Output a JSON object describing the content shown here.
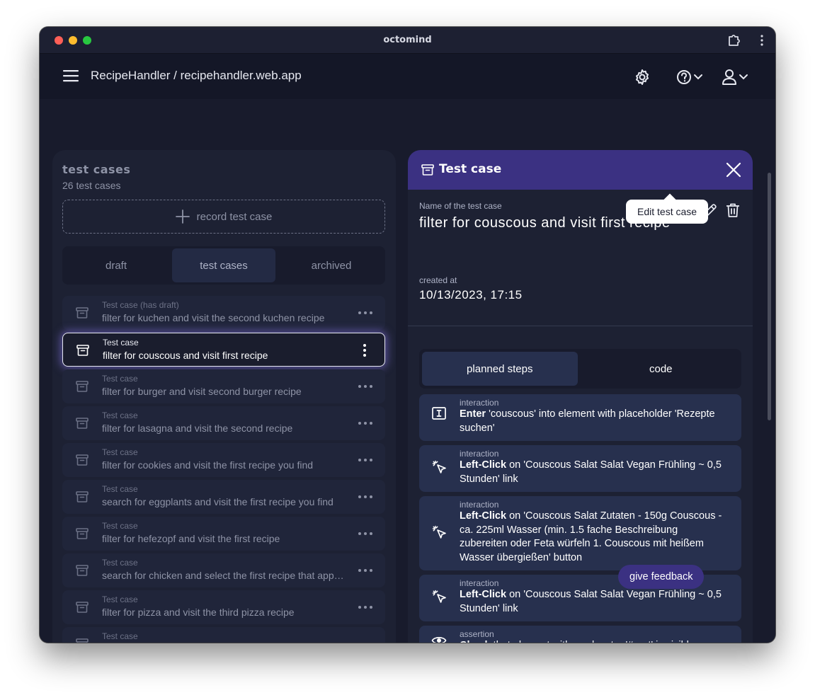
{
  "window": {
    "title": "octomind"
  },
  "appbar": {
    "project": "RecipeHandler / recipehandler.web.app"
  },
  "left_panel": {
    "title": "test cases",
    "count": "26 test cases",
    "record_label": "record test case",
    "tabs": [
      {
        "label": "draft",
        "active": false
      },
      {
        "label": "test cases",
        "active": true
      },
      {
        "label": "archived",
        "active": false
      }
    ],
    "items": [
      {
        "kind": "Test case (has draft)",
        "name": "filter for kuchen and visit the second kuchen recipe"
      },
      {
        "kind": "Test case",
        "name": "filter for couscous and visit first recipe",
        "selected": true
      },
      {
        "kind": "Test case",
        "name": "filter for burger and visit second burger recipe"
      },
      {
        "kind": "Test case",
        "name": "filter for lasagna and visit the second recipe"
      },
      {
        "kind": "Test case",
        "name": "filter for cookies and visit the first recipe you find"
      },
      {
        "kind": "Test case",
        "name": "search for eggplants and visit the first recipe you find"
      },
      {
        "kind": "Test case",
        "name": "filter for hefezopf and visit the first recipe"
      },
      {
        "kind": "Test case",
        "name": "search for chicken and select the first recipe that appears"
      },
      {
        "kind": "Test case",
        "name": "filter for pizza and visit the third pizza recipe"
      },
      {
        "kind": "Test case",
        "name": ""
      }
    ]
  },
  "detail": {
    "header_title": "Test case",
    "name_label": "Name of the test case",
    "name": "filter for couscous and visit first recipe",
    "created_label": "created at",
    "created_value": "10/13/2023, 17:15",
    "tabs": [
      {
        "label": "planned steps",
        "active": true
      },
      {
        "label": "code",
        "active": false
      }
    ],
    "steps": [
      {
        "kind": "interaction",
        "icon": "text-input-icon",
        "action": "Enter",
        "text": " 'couscous' into element with placeholder 'Rezepte suchen'"
      },
      {
        "kind": "interaction",
        "icon": "cursor-click-icon",
        "action": "Left-Click",
        "text": " on 'Couscous Salat Salat Vegan Frühling ~ 0,5 Stunden' link"
      },
      {
        "kind": "interaction",
        "icon": "cursor-click-icon",
        "action": "Left-Click",
        "text": " on 'Couscous Salat Zutaten - 150g Couscous - ca. 225ml Wasser (min. 1.5 fache Beschreibung zubereiten oder Feta würfeln 1. Couscous mit heißem Wasser übergießen' button"
      },
      {
        "kind": "interaction",
        "icon": "cursor-click-icon",
        "action": "Left-Click",
        "text": " on 'Couscous Salat Salat Vegan Frühling ~ 0,5 Stunden' link"
      },
      {
        "kind": "assertion",
        "icon": "eye-icon",
        "action": "Check",
        "text": " that element with css locator '#root' is visible"
      }
    ]
  },
  "tooltip": {
    "text": "Edit test case"
  },
  "feedback": {
    "label": "give feedback"
  },
  "colors": {
    "background": "#181b2c",
    "panel": "#1d2133",
    "accent": "#3b3182",
    "step_card": "#27304e"
  }
}
